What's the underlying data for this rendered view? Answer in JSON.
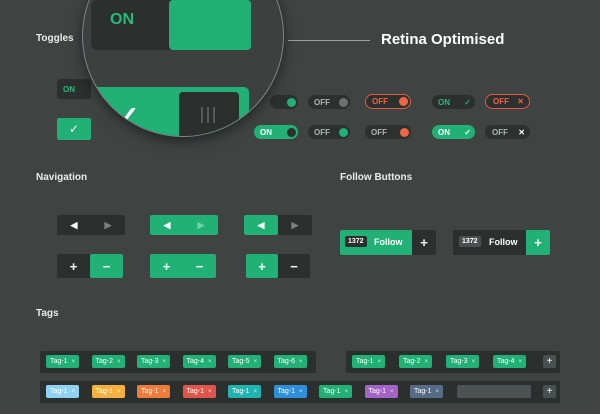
{
  "sections": {
    "toggles": "Toggles",
    "navigation": "Navigation",
    "follow": "Follow Buttons",
    "tags": "Tags"
  },
  "banner": "Retina Optimised",
  "magnifier": {
    "on_label": "ON"
  },
  "toggles": {
    "on": "ON",
    "off": "OFF",
    "check": "✓",
    "cross": "✕"
  },
  "nav": {
    "left": "◀",
    "right": "▶",
    "plus": "+",
    "minus": "−"
  },
  "follow": [
    {
      "count": "1372",
      "label": "Follow",
      "plus": "+"
    },
    {
      "count": "1372",
      "label": "Follow",
      "plus": "+"
    }
  ],
  "tags_row1": [
    "Tag-1",
    "Tag-2",
    "Tag-3",
    "Tag-4",
    "Tag-5",
    "Tag-6"
  ],
  "tags_row1b": [
    "Tag-1",
    "Tag-2",
    "Tag-3",
    "Tag-4"
  ],
  "tags_row2": [
    "Tag-1",
    "Tag-1",
    "Tag-1",
    "Tag-1",
    "Tag-1",
    "Tag-1",
    "Tag-1",
    "Tag-1",
    "Tag-1"
  ],
  "tag_close": "×",
  "colors": {
    "green": "#21b075",
    "dark": "#2b2f2e",
    "orange": "#e15b40",
    "tag_row2": [
      "#8fd3f4",
      "#f5b040",
      "#f07c3c",
      "#e1564a",
      "#21b3b0",
      "#2f8fd8",
      "#21b075",
      "#a463c7",
      "#556b86"
    ]
  }
}
